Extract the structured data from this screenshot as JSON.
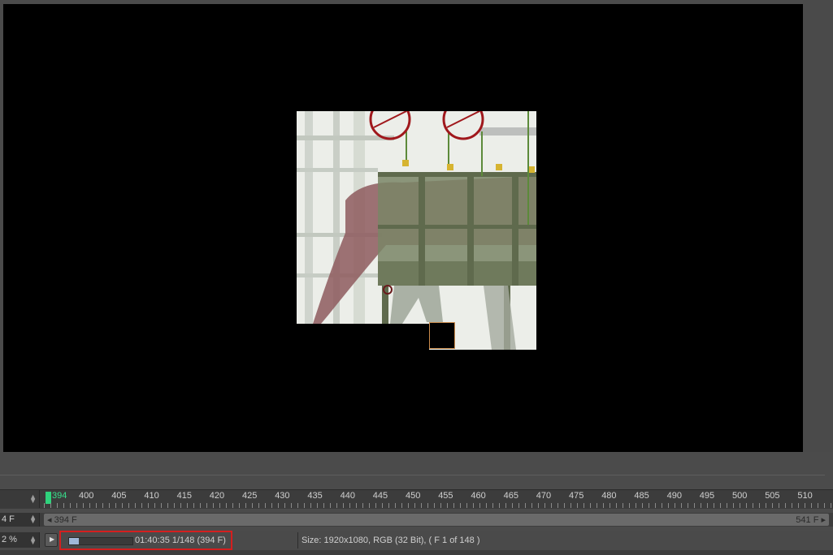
{
  "timeline": {
    "current_frame_label": "394",
    "tick_labels": [
      "400",
      "405",
      "410",
      "415",
      "420",
      "425",
      "430",
      "435",
      "440",
      "445",
      "450",
      "455",
      "460",
      "465",
      "470",
      "475",
      "480",
      "485",
      "490",
      "495",
      "500",
      "505",
      "510"
    ],
    "frame_field": "4 F",
    "range_start": "394 F",
    "range_end": "541 F"
  },
  "status": {
    "zoom": "2 %",
    "progress_fraction": 0.15,
    "time_text": "01:40:35 1/148 (394 F)",
    "size_text": "Size: 1920x1080, RGB (32 Bit),   ( F 1 of 148 )"
  },
  "colors": {
    "cursor": "#2fd27c",
    "highlight_box": "#d41f1f",
    "progress": "#9fb7d8"
  }
}
